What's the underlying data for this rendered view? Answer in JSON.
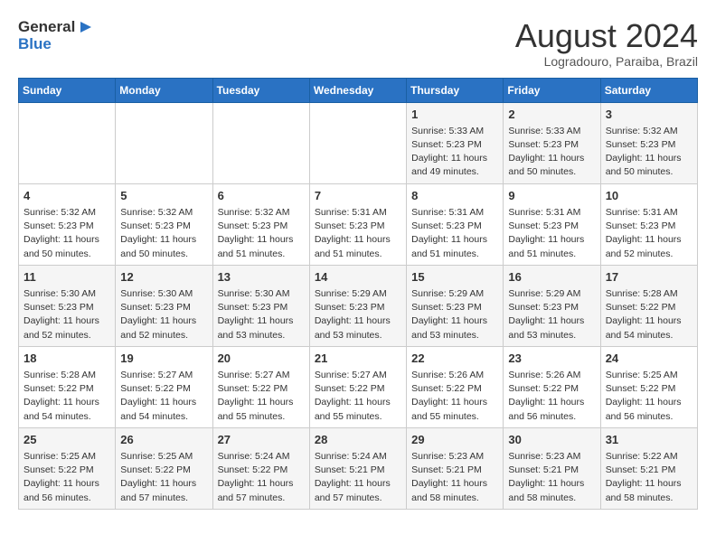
{
  "logo": {
    "general": "General",
    "blue": "Blue"
  },
  "title": {
    "month_year": "August 2024",
    "location": "Logradouro, Paraiba, Brazil"
  },
  "days_of_week": [
    "Sunday",
    "Monday",
    "Tuesday",
    "Wednesday",
    "Thursday",
    "Friday",
    "Saturday"
  ],
  "weeks": [
    [
      {
        "day": "",
        "info": ""
      },
      {
        "day": "",
        "info": ""
      },
      {
        "day": "",
        "info": ""
      },
      {
        "day": "",
        "info": ""
      },
      {
        "day": "1",
        "info": "Sunrise: 5:33 AM\nSunset: 5:23 PM\nDaylight: 11 hours\nand 49 minutes."
      },
      {
        "day": "2",
        "info": "Sunrise: 5:33 AM\nSunset: 5:23 PM\nDaylight: 11 hours\nand 50 minutes."
      },
      {
        "day": "3",
        "info": "Sunrise: 5:32 AM\nSunset: 5:23 PM\nDaylight: 11 hours\nand 50 minutes."
      }
    ],
    [
      {
        "day": "4",
        "info": "Sunrise: 5:32 AM\nSunset: 5:23 PM\nDaylight: 11 hours\nand 50 minutes."
      },
      {
        "day": "5",
        "info": "Sunrise: 5:32 AM\nSunset: 5:23 PM\nDaylight: 11 hours\nand 50 minutes."
      },
      {
        "day": "6",
        "info": "Sunrise: 5:32 AM\nSunset: 5:23 PM\nDaylight: 11 hours\nand 51 minutes."
      },
      {
        "day": "7",
        "info": "Sunrise: 5:31 AM\nSunset: 5:23 PM\nDaylight: 11 hours\nand 51 minutes."
      },
      {
        "day": "8",
        "info": "Sunrise: 5:31 AM\nSunset: 5:23 PM\nDaylight: 11 hours\nand 51 minutes."
      },
      {
        "day": "9",
        "info": "Sunrise: 5:31 AM\nSunset: 5:23 PM\nDaylight: 11 hours\nand 51 minutes."
      },
      {
        "day": "10",
        "info": "Sunrise: 5:31 AM\nSunset: 5:23 PM\nDaylight: 11 hours\nand 52 minutes."
      }
    ],
    [
      {
        "day": "11",
        "info": "Sunrise: 5:30 AM\nSunset: 5:23 PM\nDaylight: 11 hours\nand 52 minutes."
      },
      {
        "day": "12",
        "info": "Sunrise: 5:30 AM\nSunset: 5:23 PM\nDaylight: 11 hours\nand 52 minutes."
      },
      {
        "day": "13",
        "info": "Sunrise: 5:30 AM\nSunset: 5:23 PM\nDaylight: 11 hours\nand 53 minutes."
      },
      {
        "day": "14",
        "info": "Sunrise: 5:29 AM\nSunset: 5:23 PM\nDaylight: 11 hours\nand 53 minutes."
      },
      {
        "day": "15",
        "info": "Sunrise: 5:29 AM\nSunset: 5:23 PM\nDaylight: 11 hours\nand 53 minutes."
      },
      {
        "day": "16",
        "info": "Sunrise: 5:29 AM\nSunset: 5:23 PM\nDaylight: 11 hours\nand 53 minutes."
      },
      {
        "day": "17",
        "info": "Sunrise: 5:28 AM\nSunset: 5:22 PM\nDaylight: 11 hours\nand 54 minutes."
      }
    ],
    [
      {
        "day": "18",
        "info": "Sunrise: 5:28 AM\nSunset: 5:22 PM\nDaylight: 11 hours\nand 54 minutes."
      },
      {
        "day": "19",
        "info": "Sunrise: 5:27 AM\nSunset: 5:22 PM\nDaylight: 11 hours\nand 54 minutes."
      },
      {
        "day": "20",
        "info": "Sunrise: 5:27 AM\nSunset: 5:22 PM\nDaylight: 11 hours\nand 55 minutes."
      },
      {
        "day": "21",
        "info": "Sunrise: 5:27 AM\nSunset: 5:22 PM\nDaylight: 11 hours\nand 55 minutes."
      },
      {
        "day": "22",
        "info": "Sunrise: 5:26 AM\nSunset: 5:22 PM\nDaylight: 11 hours\nand 55 minutes."
      },
      {
        "day": "23",
        "info": "Sunrise: 5:26 AM\nSunset: 5:22 PM\nDaylight: 11 hours\nand 56 minutes."
      },
      {
        "day": "24",
        "info": "Sunrise: 5:25 AM\nSunset: 5:22 PM\nDaylight: 11 hours\nand 56 minutes."
      }
    ],
    [
      {
        "day": "25",
        "info": "Sunrise: 5:25 AM\nSunset: 5:22 PM\nDaylight: 11 hours\nand 56 minutes."
      },
      {
        "day": "26",
        "info": "Sunrise: 5:25 AM\nSunset: 5:22 PM\nDaylight: 11 hours\nand 57 minutes."
      },
      {
        "day": "27",
        "info": "Sunrise: 5:24 AM\nSunset: 5:22 PM\nDaylight: 11 hours\nand 57 minutes."
      },
      {
        "day": "28",
        "info": "Sunrise: 5:24 AM\nSunset: 5:21 PM\nDaylight: 11 hours\nand 57 minutes."
      },
      {
        "day": "29",
        "info": "Sunrise: 5:23 AM\nSunset: 5:21 PM\nDaylight: 11 hours\nand 58 minutes."
      },
      {
        "day": "30",
        "info": "Sunrise: 5:23 AM\nSunset: 5:21 PM\nDaylight: 11 hours\nand 58 minutes."
      },
      {
        "day": "31",
        "info": "Sunrise: 5:22 AM\nSunset: 5:21 PM\nDaylight: 11 hours\nand 58 minutes."
      }
    ]
  ]
}
